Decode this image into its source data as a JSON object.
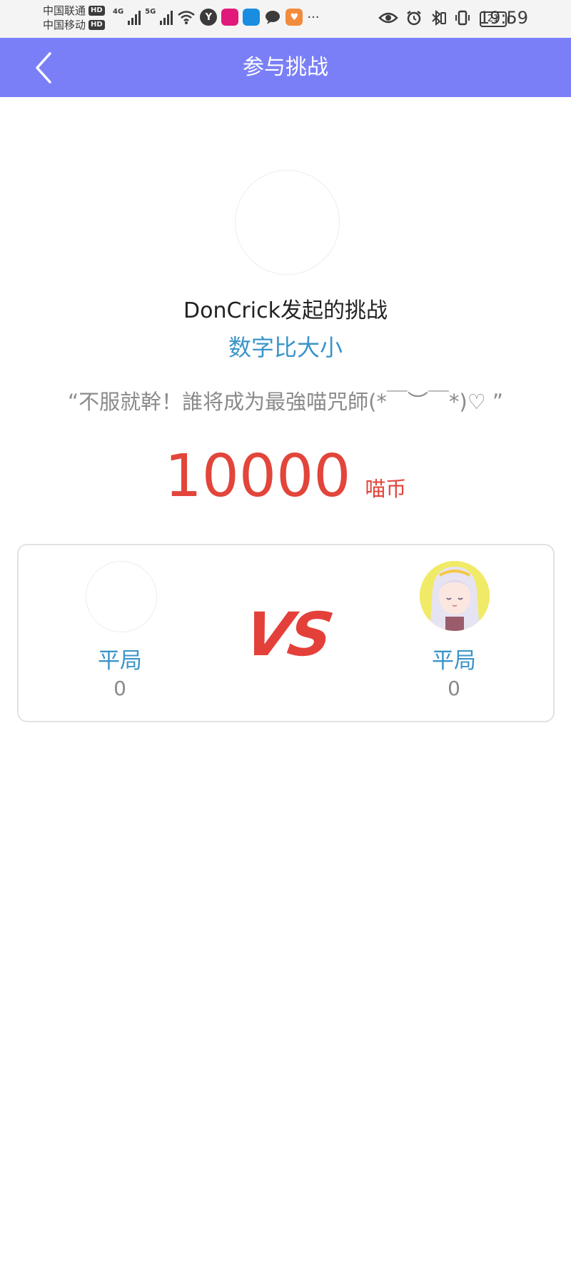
{
  "status_bar": {
    "carrier_1": "中国联通",
    "carrier_2": "中国移动",
    "hd_badge": "HD",
    "network_1": "4G",
    "network_2": "5G",
    "app_icon_y": "Y",
    "more": "···",
    "battery": "21",
    "time": "19:59"
  },
  "header": {
    "title": "参与挑战",
    "background_color": "#7a7ff8"
  },
  "challenge": {
    "initiator_text": "DonCrick发起的挑战",
    "game_name": "数字比大小",
    "quote": "“不服就幹！誰将成为最強喵咒師(*￣︶￣*)♡ ”",
    "stake_amount": "10000",
    "stake_unit": "喵币"
  },
  "versus": {
    "vs_label": "VS",
    "left_player": {
      "result": "平局",
      "score": "0"
    },
    "right_player": {
      "result": "平局",
      "score": "0"
    }
  },
  "colors": {
    "accent_blue": "#3a94c9",
    "stake_red": "#e2453a",
    "vs_red": "#e4403a"
  }
}
